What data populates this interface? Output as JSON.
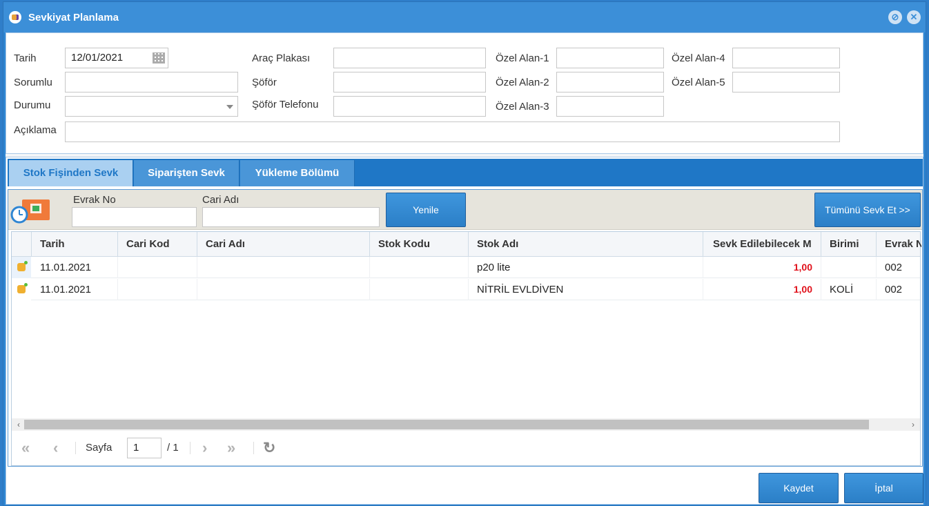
{
  "window": {
    "title": "Sevkiyat Planlama",
    "minimize_glyph": "⊘",
    "close_glyph": "✕"
  },
  "form": {
    "tarih_label": "Tarih",
    "tarih_value": "12/01/2021",
    "sorumlu_label": "Sorumlu",
    "sorumlu_value": "",
    "durumu_label": "Durumu",
    "durumu_value": "",
    "aciklama_label": "Açıklama",
    "aciklama_value": "",
    "arac_plakasi_label": "Araç Plakası",
    "arac_plakasi_value": "",
    "sofor_label": "Şöför",
    "sofor_value": "",
    "sofor_telefonu_label": "Şöför Telefonu",
    "sofor_telefonu_value": "",
    "ozel_alan_1_label": "Özel Alan-1",
    "ozel_alan_2_label": "Özel Alan-2",
    "ozel_alan_3_label": "Özel Alan-3",
    "ozel_alan_4_label": "Özel Alan-4",
    "ozel_alan_5_label": "Özel Alan-5"
  },
  "tabs": [
    {
      "label": "Stok Fişinden Sevk",
      "active": true
    },
    {
      "label": "Siparişten Sevk",
      "active": false
    },
    {
      "label": "Yükleme Bölümü",
      "active": false
    }
  ],
  "filter": {
    "evrak_no_label": "Evrak No",
    "evrak_no_value": "",
    "cari_adi_label": "Cari Adı",
    "cari_adi_value": "",
    "yenile_label": "Yenile",
    "tumunu_sevk_label": "Tümünü Sevk Et >>"
  },
  "grid": {
    "columns": [
      "Tarih",
      "Cari Kod",
      "Cari Adı",
      "Stok Kodu",
      "Stok Adı",
      "Sevk Edilebilecek M",
      "Birimi",
      "Evrak No"
    ],
    "rows": [
      {
        "tarih": "11.01.2021",
        "cari_kod": "",
        "cari_adi": "",
        "stok_kodu": "",
        "stok_adi": "p20 lite",
        "sevk": "1,00",
        "birimi": "",
        "evrak": "002"
      },
      {
        "tarih": "11.01.2021",
        "cari_kod": "",
        "cari_adi": "",
        "stok_kodu": "",
        "stok_adi": "NİTRİL EVLDİVEN",
        "sevk": "1,00",
        "birimi": "KOLİ",
        "evrak": "002"
      }
    ]
  },
  "pager": {
    "sayfa_label": "Sayfa",
    "page": "1",
    "total": "/ 1"
  },
  "footer": {
    "kaydet_label": "Kaydet",
    "iptal_label": "İptal"
  },
  "colors": {
    "accent": "#2f86d3",
    "value_red": "#e0101a"
  }
}
